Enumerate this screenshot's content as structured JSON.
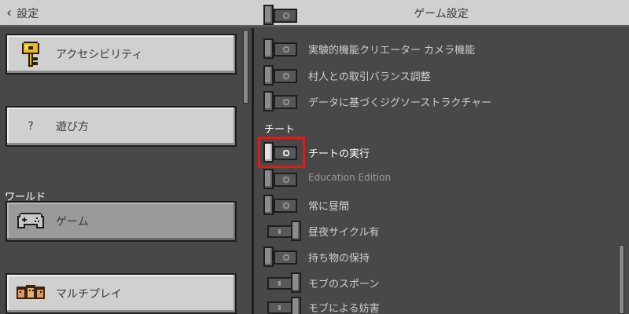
{
  "header": {
    "back_label": "設定",
    "title": "ゲーム設定"
  },
  "sidebar": {
    "buttons": [
      {
        "label": "アクセシビリティ",
        "icon": "key-icon"
      },
      {
        "label": "遊び方",
        "icon": "question-mark-icon",
        "glyph": "?"
      },
      {
        "label": "ゲーム",
        "icon": "controller-icon",
        "selected": true
      },
      {
        "label": "マルチプレイ",
        "icon": "players-icon"
      }
    ],
    "world_section": "ワールド"
  },
  "settings": {
    "experimental": [
      {
        "label": "実験的機能クリエーター カメラ機能",
        "value": false
      },
      {
        "label": "村人との取引バランス調整",
        "value": false
      },
      {
        "label": "データに基づくジグソーストラクチャー",
        "value": false
      }
    ],
    "cheats_section": "チート",
    "cheats": [
      {
        "label": "チートの実行",
        "value": false,
        "highlighted": true
      },
      {
        "label": "Education Edition",
        "value": false
      },
      {
        "label": "常に昼間",
        "value": false
      },
      {
        "label": "昼夜サイクル有",
        "value": true
      },
      {
        "label": "持ち物の保持",
        "value": false
      },
      {
        "label": "モブのスポーン",
        "value": true
      },
      {
        "label": "モブによる妨害",
        "value": true
      }
    ]
  },
  "colors": {
    "highlight": "#e01919",
    "panel": "#484848",
    "button": "#d0d0d0"
  }
}
